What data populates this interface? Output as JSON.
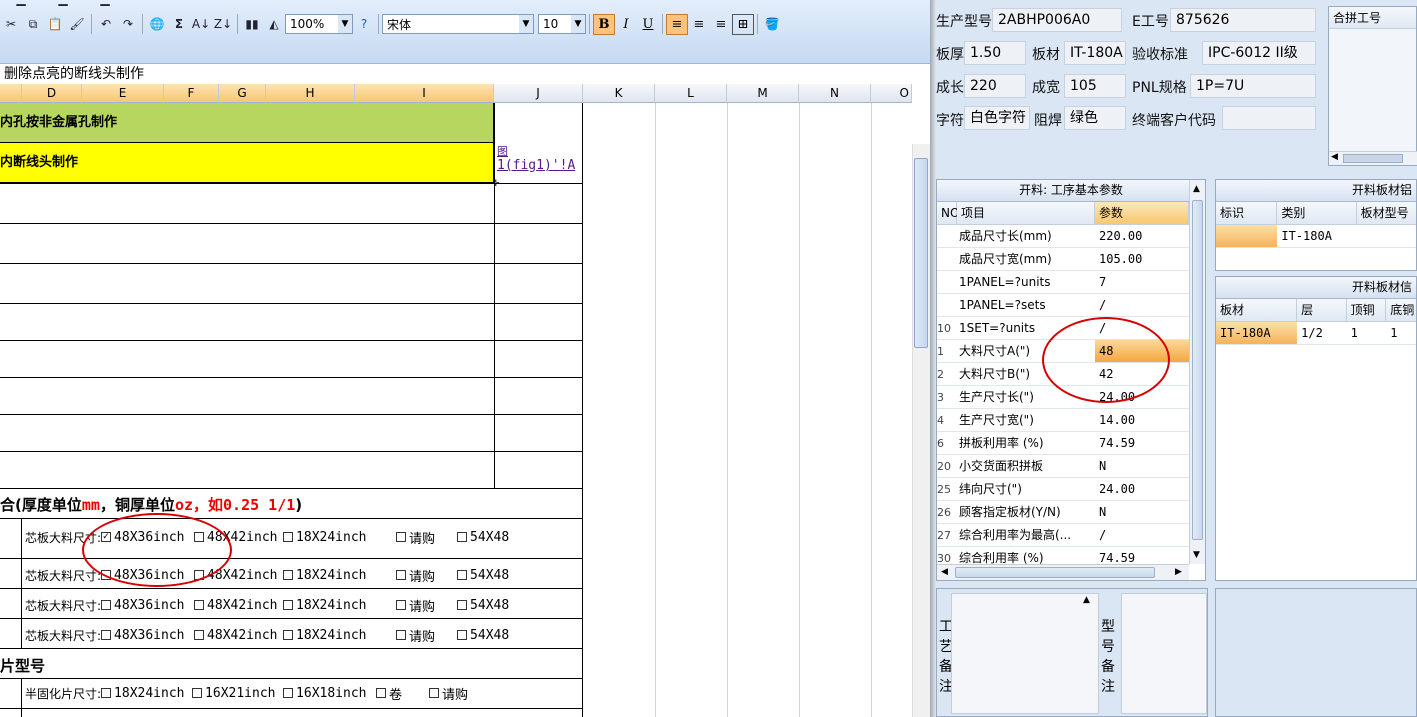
{
  "excel": {
    "toolbar": {
      "zoom": "100%",
      "font_name": "宋体",
      "font_size": "10",
      "bold": "B",
      "italic": "I",
      "underline": "U"
    },
    "instruction": "删除点亮的断线头制作",
    "columns": [
      "D",
      "E",
      "F",
      "G",
      "H",
      "I",
      "J",
      "K",
      "L",
      "M",
      "N",
      "O"
    ],
    "rows": {
      "green_label": "内孔按非金属孔制作",
      "yellow_label": "内断线头制作",
      "fig_icon": "图",
      "fig_link": "1(fig1)'!A"
    },
    "section1": {
      "prefix": "合",
      "title_a": "(厚度单位",
      "unit_mm": "mm",
      "title_b": "，铜厚单位",
      "unit_oz": "oz",
      "title_c": "，如",
      "example": "0.25 1/1",
      "title_d": ")"
    },
    "core_rows": [
      {
        "label": "芯板大料尺寸:",
        "opt1": "48X36inch",
        "opt2": "48X42inch",
        "opt3": "18X24inch",
        "opt4": "请购",
        "opt5": "54X48",
        "checked": true
      },
      {
        "label": "芯板大料尺寸:",
        "opt1": "48X36inch",
        "opt2": "48X42inch",
        "opt3": "18X24inch",
        "opt4": "请购",
        "opt5": "54X48",
        "checked": false
      },
      {
        "label": "芯板大料尺寸:",
        "opt1": "48X36inch",
        "opt2": "48X42inch",
        "opt3": "18X24inch",
        "opt4": "请购",
        "opt5": "54X48",
        "checked": false
      },
      {
        "label": "芯板大料尺寸:",
        "opt1": "48X36inch",
        "opt2": "48X42inch",
        "opt3": "18X24inch",
        "opt4": "请购",
        "opt5": "54X48",
        "checked": false
      }
    ],
    "section2": {
      "title": "片型号"
    },
    "prepreg_row": {
      "label": "半固化片尺寸:",
      "opt1": "18X24inch",
      "opt2": "16X21inch",
      "opt3": "16X18inch",
      "opt4": "卷",
      "opt5": "请购"
    }
  },
  "erp": {
    "header": {
      "product_model_label": "生产型号",
      "product_model": "2ABHP006A0",
      "eng_no_label": "E工号",
      "eng_no": "875626",
      "thickness_label": "板厚",
      "thickness": "1.50",
      "material_label": "板材",
      "material": "IT-180A",
      "standard_label": "验收标准",
      "standard": "IPC-6012 II级",
      "length_label": "成长",
      "length": "220",
      "width_label": "成宽",
      "width": "105",
      "pnl_label": "PNL规格",
      "pnl": "1P=7U",
      "silk_label": "字符",
      "silk": "白色字符",
      "mask_label": "阻焊",
      "mask": "绿色",
      "customer_label": "终端客户代码",
      "customer": "",
      "merge_label": "合拼工号"
    },
    "params": {
      "title": "开料: 工序基本参数",
      "col_no": "NO",
      "col_item": "项目",
      "col_value": "参数",
      "rows": [
        {
          "no": "",
          "item": "成品尺寸长(mm)",
          "value": "220.00"
        },
        {
          "no": "",
          "item": "成品尺寸宽(mm)",
          "value": "105.00"
        },
        {
          "no": "",
          "item": "1PANEL=?units",
          "value": "7"
        },
        {
          "no": "",
          "item": "1PANEL=?sets",
          "value": "/"
        },
        {
          "no": "10",
          "item": "1SET=?units",
          "value": "/"
        },
        {
          "no": "1",
          "item": "大料尺寸A(\")",
          "value": "48"
        },
        {
          "no": "2",
          "item": "大料尺寸B(\")",
          "value": "42"
        },
        {
          "no": "3",
          "item": "生产尺寸长(\")",
          "value": "24.00"
        },
        {
          "no": "4",
          "item": "生产尺寸宽(\")",
          "value": "14.00"
        },
        {
          "no": "6",
          "item": "拼板利用率 (%)",
          "value": "74.59"
        },
        {
          "no": "20",
          "item": "小交货面积拼板",
          "value": "N"
        },
        {
          "no": "25",
          "item": "纬向尺寸(\")",
          "value": "24.00"
        },
        {
          "no": "26",
          "item": "顾客指定板材(Y/N)",
          "value": "N"
        },
        {
          "no": "27",
          "item": "综合利用率为最高(...",
          "value": "/"
        },
        {
          "no": "30",
          "item": "综合利用率 (%)",
          "value": "74.59"
        }
      ]
    },
    "material_panel": {
      "title": "开料板材铝",
      "col1": "标识",
      "col2": "类别",
      "col3": "板材型号",
      "row": {
        "c1": "",
        "c2": "IT-180A",
        "c3": ""
      }
    },
    "board_panel": {
      "title": "开料板材信",
      "col1": "板材",
      "col2": "层",
      "col3": "顶铜",
      "col4": "底铜",
      "row": {
        "c1": "IT-180A",
        "c2": "1/2",
        "c3": "1",
        "c4": "1"
      }
    },
    "notes": {
      "craft_label": "工艺备注",
      "model_label": "型号备注"
    }
  }
}
